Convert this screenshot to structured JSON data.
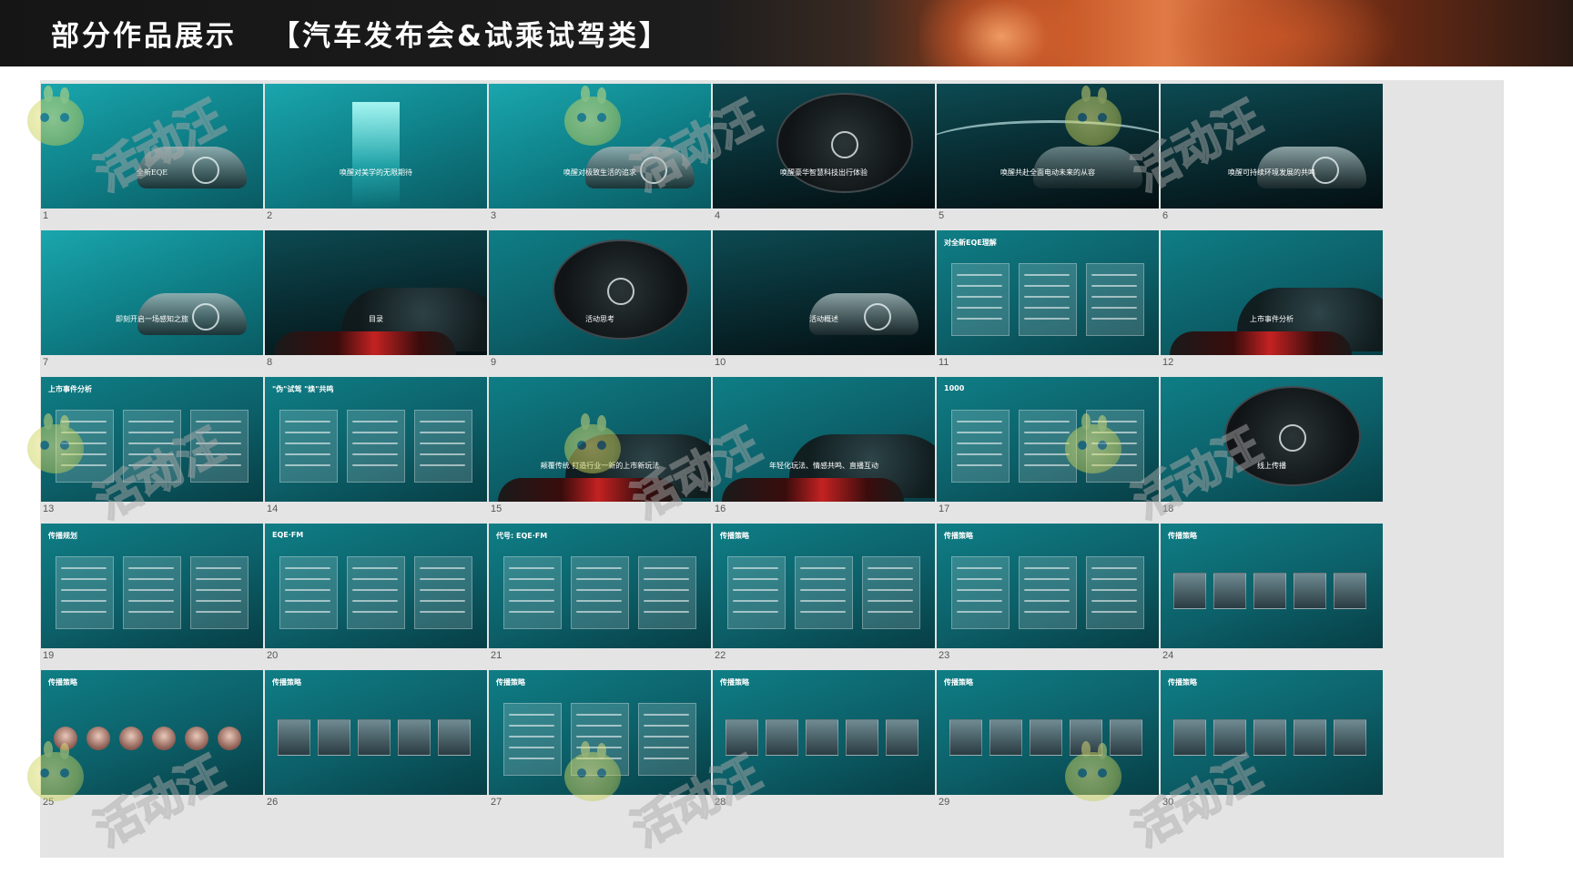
{
  "header": {
    "title": "部分作品展示",
    "category": "【汽车发布会&试乘试驾类】"
  },
  "watermark_text": "活动汪",
  "slides": [
    {
      "num": "1",
      "style": "bright",
      "art": "car",
      "text": "全新EQE"
    },
    {
      "num": "2",
      "style": "bright",
      "art": "beam",
      "text": "唤醒对美学的无限期待"
    },
    {
      "num": "3",
      "style": "bright",
      "art": "car",
      "text": "唤醒对极致生活的追求"
    },
    {
      "num": "4",
      "style": "dark",
      "art": "stars",
      "text": "唤醒豪华智慧科技出行体验"
    },
    {
      "num": "5",
      "style": "dark",
      "art": "wave",
      "text": "唤醒共赴全面电动未来的从容"
    },
    {
      "num": "6",
      "style": "dark",
      "art": "car",
      "text": "唤醒可持续环境发展的共鸣"
    },
    {
      "num": "7",
      "style": "bright",
      "art": "car",
      "text": "即刻开启一场感知之旅"
    },
    {
      "num": "8",
      "style": "dark",
      "art": "taillight",
      "text": "目录"
    },
    {
      "num": "9",
      "style": "normal",
      "art": "stars",
      "text": "活动思考"
    },
    {
      "num": "10",
      "style": "dark",
      "art": "car",
      "text": "活动概述"
    },
    {
      "num": "11",
      "style": "normal",
      "art": "panel",
      "text": "对全新EQE理解"
    },
    {
      "num": "12",
      "style": "normal",
      "art": "taillight",
      "text": "上市事件分析"
    },
    {
      "num": "13",
      "style": "normal",
      "art": "panel",
      "text": "上市事件分析"
    },
    {
      "num": "14",
      "style": "normal",
      "art": "panel",
      "text": "\"伪\"试驾 \"焕\"共鸣"
    },
    {
      "num": "15",
      "style": "normal",
      "art": "taillight",
      "text": "颠覆传统 打造行业一新的上市新玩法"
    },
    {
      "num": "16",
      "style": "normal",
      "art": "taillight",
      "text": "年轻化玩法、情感共鸣、直播互动"
    },
    {
      "num": "17",
      "style": "normal",
      "art": "panel",
      "text": "1000"
    },
    {
      "num": "18",
      "style": "normal",
      "art": "stars",
      "text": "线上传播"
    },
    {
      "num": "19",
      "style": "normal",
      "art": "panel",
      "text": "传播规划"
    },
    {
      "num": "20",
      "style": "normal",
      "art": "panel",
      "text": "EQE·FM"
    },
    {
      "num": "21",
      "style": "normal",
      "art": "panel",
      "text": "代号: EQE·FM"
    },
    {
      "num": "22",
      "style": "normal",
      "art": "panel",
      "text": "传播策略"
    },
    {
      "num": "23",
      "style": "normal",
      "art": "panel",
      "text": "传播策略"
    },
    {
      "num": "24",
      "style": "normal",
      "art": "photos",
      "text": "传播策略"
    },
    {
      "num": "25",
      "style": "normal",
      "art": "faces",
      "text": "传播策略"
    },
    {
      "num": "26",
      "style": "normal",
      "art": "photos",
      "text": "传播策略"
    },
    {
      "num": "27",
      "style": "normal",
      "art": "panel",
      "text": "传播策略"
    },
    {
      "num": "28",
      "style": "normal",
      "art": "photos",
      "text": "传播策略"
    },
    {
      "num": "29",
      "style": "normal",
      "art": "photos",
      "text": "传播策略"
    },
    {
      "num": "30",
      "style": "normal",
      "art": "photos",
      "text": "传播策略"
    }
  ]
}
